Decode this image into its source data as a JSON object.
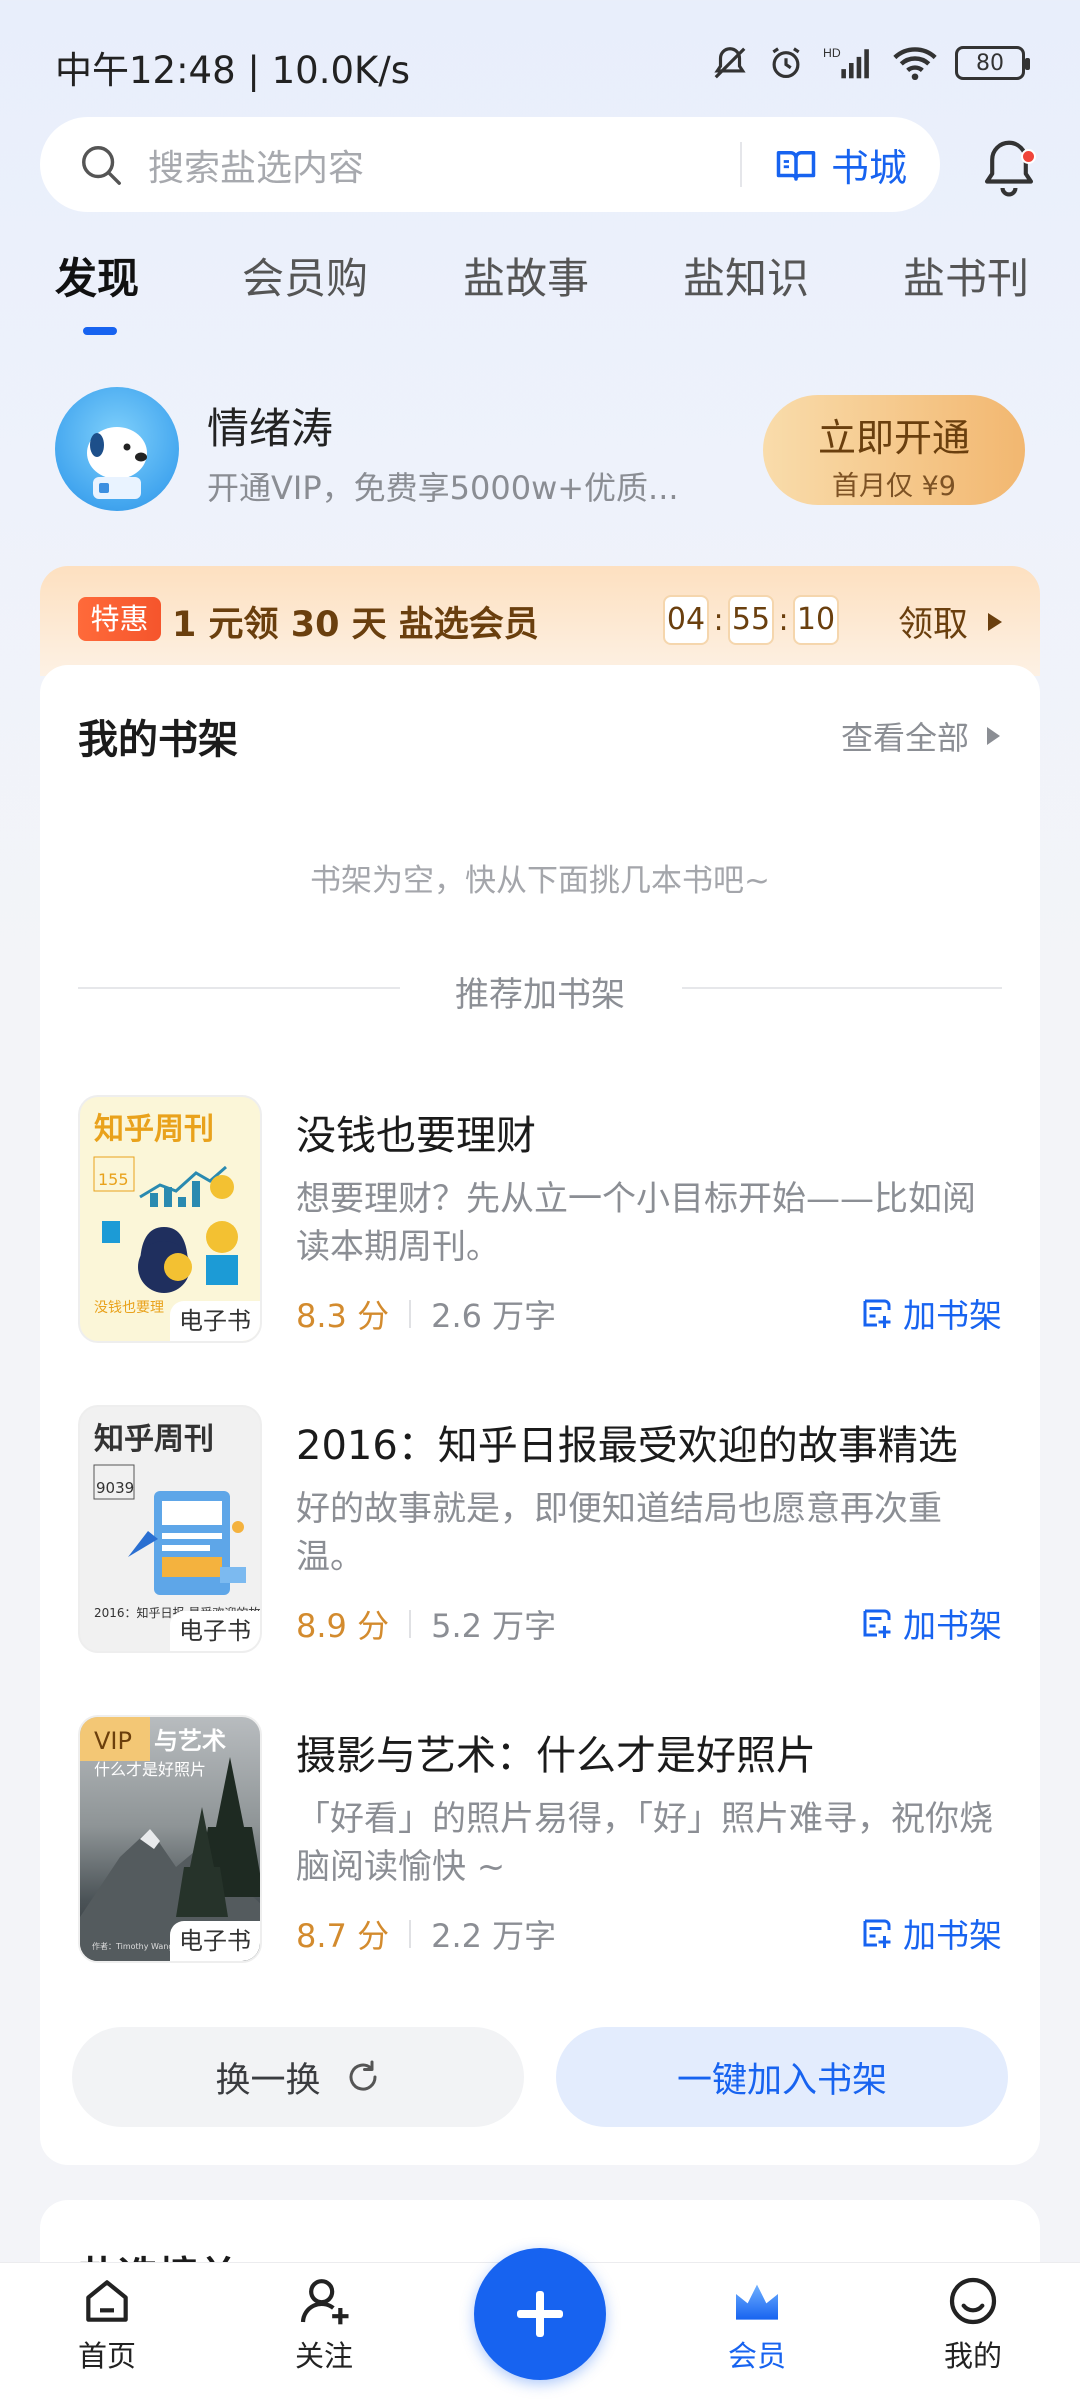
{
  "status_bar": {
    "time": "中午12:48 | 10.0K/s",
    "battery": "80"
  },
  "search": {
    "placeholder": "搜索盐选内容",
    "bookstore_label": "书城"
  },
  "tabs": [
    "发现",
    "会员购",
    "盐故事",
    "盐知识",
    "盐书刊"
  ],
  "vip": {
    "name": "情绪涛",
    "desc": "开通VIP，免费享5000w+优质...",
    "button_label": "立即开通",
    "button_sub": "首月仅 ¥9"
  },
  "promo": {
    "tag": "特惠",
    "text": "1 元领 30 天 盐选会员",
    "timer": [
      "04",
      "55",
      "10"
    ],
    "claim_label": "领取"
  },
  "shelf": {
    "title": "我的书架",
    "view_all": "查看全部",
    "empty_text": "书架为空，快从下面挑几本书吧~",
    "recommend_label": "推荐加书架",
    "books": [
      {
        "title": "没钱也要理财",
        "desc": "想要理财？先从立一个小目标开始——比如阅读本期周刊。",
        "score": "8.3 分",
        "words": "2.6 万字",
        "badge": "电子书",
        "add_label": "加书架",
        "cover_title": "知乎周刊",
        "cover_num": "155",
        "cover_tagline": "没钱也要理"
      },
      {
        "title": "2016：知乎日报最受欢迎的故事精选",
        "desc": "好的故事就是，即便知道结局也愿意再次重温。",
        "score": "8.9 分",
        "words": "5.2 万字",
        "badge": "电子书",
        "add_label": "加书架",
        "cover_title": "知乎周刊",
        "cover_num": "9039",
        "cover_tagline": "2016：知乎日报 最受欢迎的故"
      },
      {
        "title": "摄影与艺术：什么才是好照片",
        "desc": "「好看」的照片易得，「好」照片难寻，祝你烧脑阅读愉快 ~",
        "score": "8.7 分",
        "words": "2.2 万字",
        "badge": "电子书",
        "add_label": "加书架",
        "cover_vip": "VIP",
        "cover_title": "与艺术",
        "cover_sub": "什么才是好照片",
        "cover_author": "作者：Timothy Wang"
      }
    ],
    "refresh_label": "换一换",
    "add_all_label": "一键加入书架"
  },
  "next_section": {
    "title": "盐选榜单"
  },
  "bottom_nav": {
    "home": "首页",
    "follow": "关注",
    "vip": "会员",
    "me": "我的"
  },
  "colors": {
    "accent": "#1763f0",
    "gold": "#d38b2e",
    "promo_brown": "#6a3f0e",
    "badge_red": "#f0453a"
  }
}
